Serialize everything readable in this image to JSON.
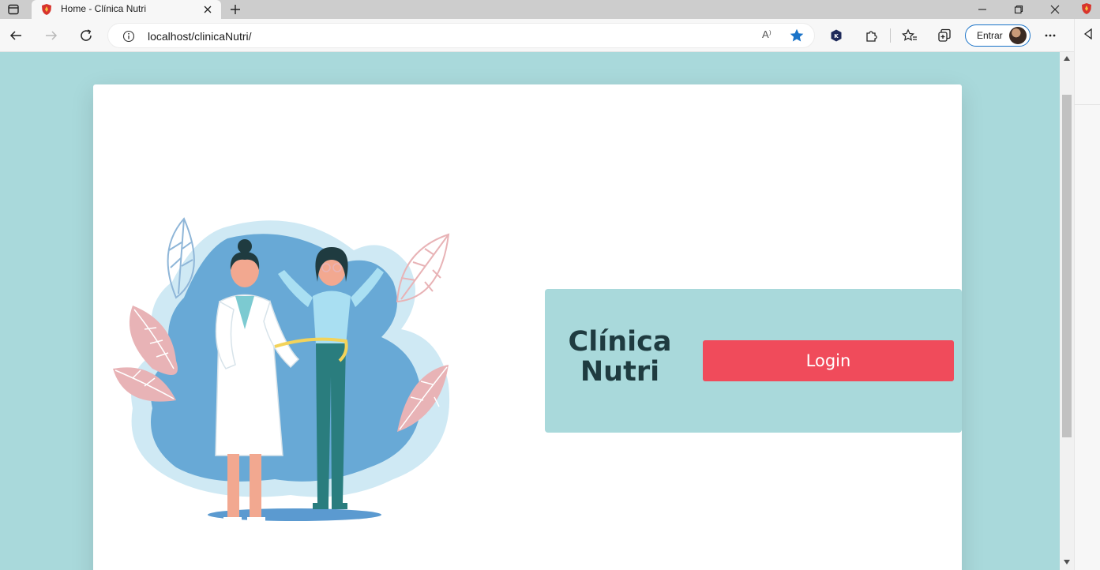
{
  "browser": {
    "tab": {
      "title": "Home - Clínica Nutri",
      "favicon": "shield-favicon"
    },
    "address": {
      "url": "localhost/clinicaNutri/",
      "read_aloud": "A⁾"
    },
    "signin_label": "Entrar",
    "icons": {
      "tab_actions": "tab-actions-icon",
      "back": "back-arrow-icon",
      "forward": "forward-arrow-icon",
      "refresh": "refresh-icon",
      "info": "info-icon",
      "favorite": "star-icon",
      "extension_a": "extension-icon",
      "extensions": "puzzle-icon",
      "favorites": "favorites-icon",
      "collections": "collections-icon",
      "menu": "more-icon"
    },
    "accent_color": "#1a73c8"
  },
  "page": {
    "background_color": "#a9d9db",
    "brand": {
      "line1": "Clínica",
      "line2": "Nutri"
    },
    "login_label": "Login",
    "login_color": "#f04b5b",
    "illustration": "nutritionist-measuring-waist-illustration"
  }
}
